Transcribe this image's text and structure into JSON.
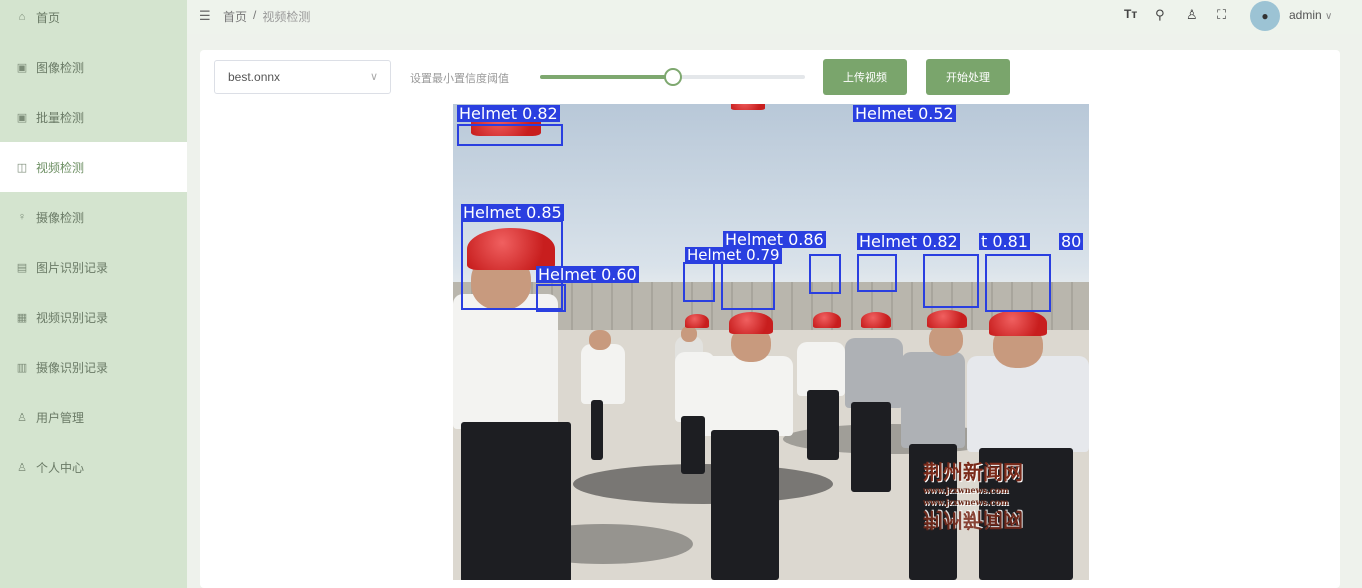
{
  "sidebar": {
    "items": [
      {
        "label": "首页",
        "icon": "home-icon"
      },
      {
        "label": "图像检测",
        "icon": "image-icon"
      },
      {
        "label": "批量检测",
        "icon": "batch-icon"
      },
      {
        "label": "视频检测",
        "icon": "video-icon",
        "active": true
      },
      {
        "label": "摄像检测",
        "icon": "camera-icon"
      },
      {
        "label": "图片识别记录",
        "icon": "record-icon"
      },
      {
        "label": "视频识别记录",
        "icon": "video-record-icon"
      },
      {
        "label": "摄像识别记录",
        "icon": "camera-record-icon"
      },
      {
        "label": "用户管理",
        "icon": "users-icon"
      },
      {
        "label": "个人中心",
        "icon": "user-icon"
      }
    ]
  },
  "header": {
    "breadcrumb": [
      "首页",
      "视频检测"
    ],
    "breadcrumb_sep": "/",
    "username": "admin"
  },
  "controls": {
    "model_value": "best.onnx",
    "confidence_label": "设置最小置信度阈值",
    "confidence_value": 0.5,
    "upload_button": "上传视频",
    "start_button": "开始处理"
  },
  "frame": {
    "detections": [
      {
        "label": "Helmet",
        "score": "0.82"
      },
      {
        "label": "Helmet",
        "score": "0.52"
      },
      {
        "label": "Helmet",
        "score": "0.85"
      },
      {
        "label": "Helmet",
        "score": "0.60"
      },
      {
        "label": "Helmet",
        "score": "0.86"
      },
      {
        "label": "Helmet",
        "score": "0.79"
      },
      {
        "label": "Helmet",
        "score": "0.82"
      },
      {
        "label": "Helmet",
        "score": "0.81"
      }
    ],
    "labels_text": {
      "d0": "Helmet 0.82",
      "d1": "Helmet 0.52",
      "d2": "Helmet 0.85",
      "d3": "Helmet 0.60",
      "d4": "Helmet 0.86",
      "d5": "Helmet 0.79",
      "d6": "Helmet 0.82",
      "d7": "t 0.81",
      "d8": "80"
    },
    "watermark_line1": "荆州新闻网",
    "watermark_url": "www.jzxwnews.com",
    "watermark_line2": "荆州新闻网"
  },
  "colors": {
    "accent": "#7aa56c",
    "sidebar_bg": "#d4e4cf",
    "detection_box": "#2a3fe0"
  }
}
